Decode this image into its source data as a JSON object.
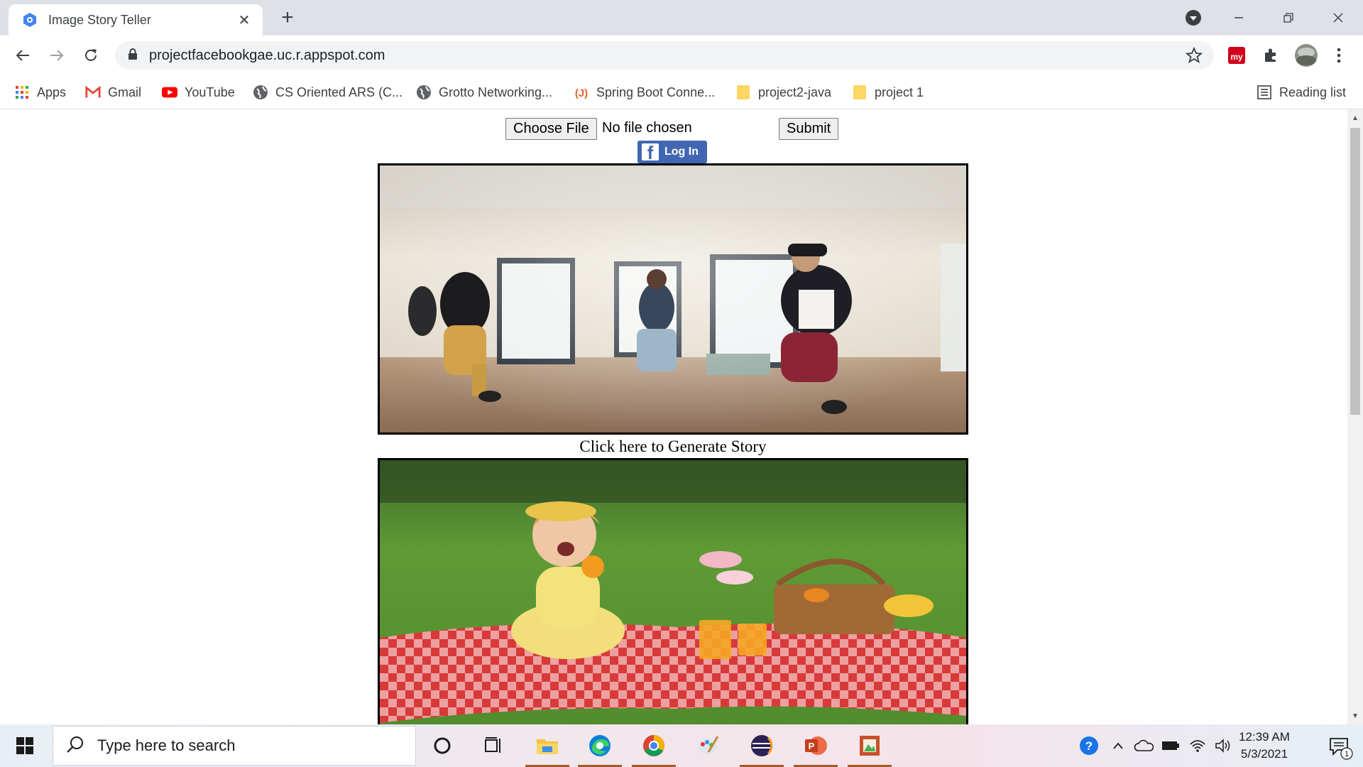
{
  "browser": {
    "tab_title": "Image Story Teller",
    "tab_close": "✕",
    "new_tab": "+",
    "url": "projectfacebookgae.uc.r.appspot.com",
    "bookmarks": [
      {
        "label": "Apps",
        "icon": "apps-grid-icon"
      },
      {
        "label": "Gmail",
        "icon": "gmail-icon"
      },
      {
        "label": "YouTube",
        "icon": "youtube-icon"
      },
      {
        "label": "CS Oriented ARS (C...",
        "icon": "globe-icon"
      },
      {
        "label": "Grotto Networking...",
        "icon": "globe-icon"
      },
      {
        "label": "Spring Boot Conne...",
        "icon": "javatpoint-icon"
      },
      {
        "label": "project2-java",
        "icon": "folder-icon"
      },
      {
        "label": "project 1",
        "icon": "folder-icon"
      }
    ],
    "reading_list": "Reading list",
    "ext_my_label": "my"
  },
  "page": {
    "choose_file_label": "Choose File",
    "no_file_text": "No file chosen",
    "submit_label": "Submit",
    "fb_login_label": "Log In",
    "generate_story_link": "Click here to Generate Story"
  },
  "taskbar": {
    "search_placeholder": "Type here to search",
    "time": "12:39 AM",
    "date": "5/3/2021",
    "notification_count": "1"
  },
  "colors": {
    "facebook_blue": "#4267b2",
    "youtube_red": "#ff0000",
    "chrome_tab_bg": "#dee1e6"
  }
}
